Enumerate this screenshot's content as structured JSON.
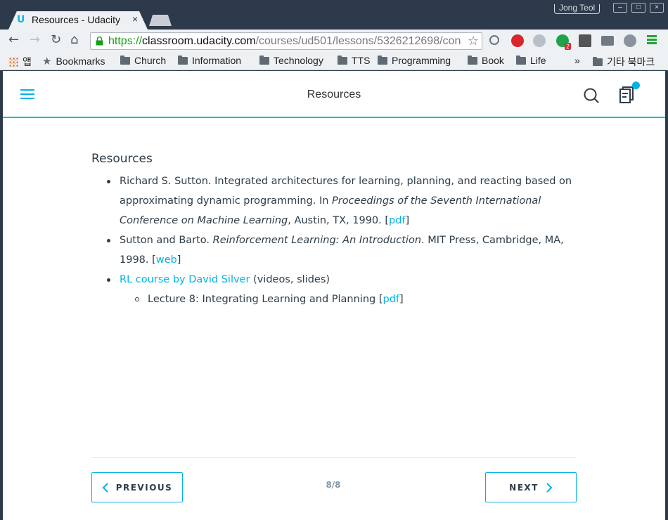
{
  "browser": {
    "tab_title": "Resources - Udacity",
    "tab_close": "×",
    "profile_name": "Jong Teol",
    "url_scheme": "https://",
    "url_host": "classroom.udacity.com",
    "url_path": "/courses/ud501/lessons/5326212698/con",
    "bookmarks": [
      {
        "label": "앱",
        "icon": "apps-icon"
      },
      {
        "label": "Bookmarks",
        "icon": "star-icon"
      },
      {
        "label": "Church",
        "icon": "folder-icon"
      },
      {
        "label": "Information",
        "icon": "folder-icon"
      },
      {
        "label": "Technology",
        "icon": "folder-icon"
      },
      {
        "label": "TTS",
        "icon": "folder-icon"
      },
      {
        "label": "Programming",
        "icon": "folder-icon"
      },
      {
        "label": "Book",
        "icon": "folder-icon"
      },
      {
        "label": "Life",
        "icon": "folder-icon"
      }
    ],
    "overflow": "»",
    "other_bookmarks": "기타 북마크",
    "extension_badge": "2"
  },
  "header": {
    "title": "Resources"
  },
  "content": {
    "heading": "Resources",
    "ref1": {
      "text_a": "Richard S. Sutton. Integrated architectures for learning, planning, and reacting based on approximating dynamic programming. In ",
      "italic": "Proceedings of the Seventh International Conference on Machine Learning",
      "text_b": ", Austin, TX, 1990. [",
      "link": "pdf",
      "text_c": "]"
    },
    "ref2": {
      "text_a": "Sutton and Barto. ",
      "italic": "Reinforcement Learning: An Introduction",
      "text_b": ". MIT Press, Cambridge, MA, 1998. [",
      "link": "web",
      "text_c": "]"
    },
    "ref3": {
      "link": "RL course by David Silver",
      "text": " (videos, slides)",
      "sub": {
        "text": "Lecture 8: Integrating Learning and Planning [",
        "link": "pdf",
        "text_c": "]"
      }
    }
  },
  "footer": {
    "prev_label": "PREVIOUS",
    "next_label": "NEXT",
    "pager": "8/8"
  },
  "colors": {
    "accent": "#02b3e4",
    "header_rule": "#15c4cc",
    "text": "#2e3d49"
  }
}
